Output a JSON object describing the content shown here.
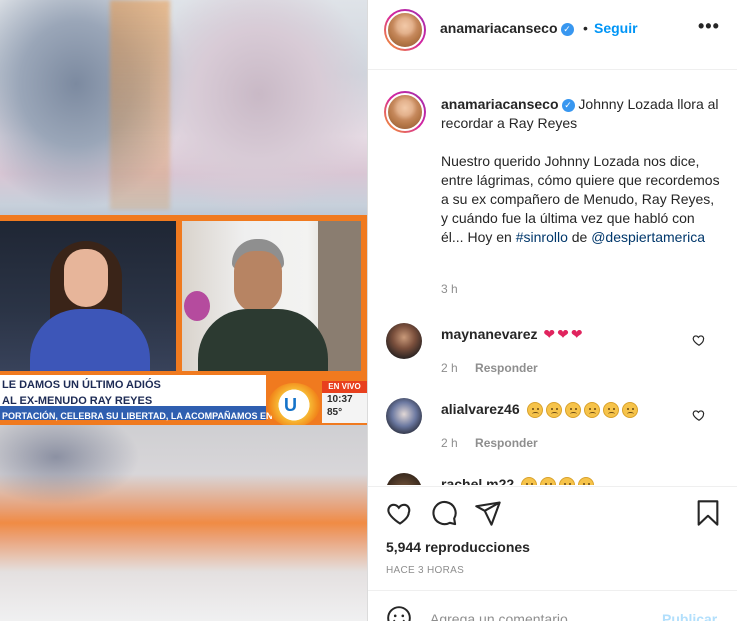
{
  "video": {
    "headline_line1": "LE DAMOS UN ÚLTIMO ADIÓS",
    "headline_line2": "AL EX-MENUDO RAY REYES",
    "ticker": "PORTACIÓN, CELEBRA SU LIBERTAD, LA ACOMPAÑAMOS EN EXCLUSI",
    "live_label": "EN VIVO",
    "clock": "10:37",
    "temperature": "85°",
    "channel_logo": "U"
  },
  "header": {
    "username": "anamariacanseco",
    "separator": "•",
    "follow_label": "Seguir",
    "more_label": "•••"
  },
  "caption": {
    "username": "anamariacanseco",
    "title": "Johnny Lozada llora al recordar a Ray Reyes",
    "body": "Nuestro querido Johnny Lozada nos dice, entre lágrimas, cómo quiere que recordemos a su ex compañero de Menudo, Ray Reyes, y cuándo fue la última vez que habló con él... Hoy en",
    "hashtag": "#sinrollo",
    "connector": "de",
    "mention": "@despiertamerica",
    "time": "3 h"
  },
  "comments": [
    {
      "username": "maynanevarez",
      "emoji_count": 3,
      "time": "2 h",
      "reply_label": "Responder"
    },
    {
      "username": "alialvarez46",
      "emoji_count": 6,
      "time": "2 h",
      "reply_label": "Responder"
    },
    {
      "username": "rachel.m22",
      "emoji_count": 4
    }
  ],
  "actions": {
    "views_count": "5,944",
    "views_label": "reproducciones",
    "posted": "HACE 3 HORAS"
  },
  "composer": {
    "placeholder": "Agrega un comentario...",
    "publish_label": "Publicar"
  },
  "colors": {
    "link_blue": "#0095f6",
    "hashtag_blue": "#00376b",
    "heart_red": "#e0245e",
    "meta_gray": "#8e8e8e",
    "broadcast_orange": "#f07a1f"
  },
  "icons": [
    "verified-badge-icon",
    "more-options-icon",
    "heart-icon",
    "comment-icon",
    "share-icon",
    "bookmark-icon",
    "emoji-icon",
    "comment-like-icon"
  ]
}
